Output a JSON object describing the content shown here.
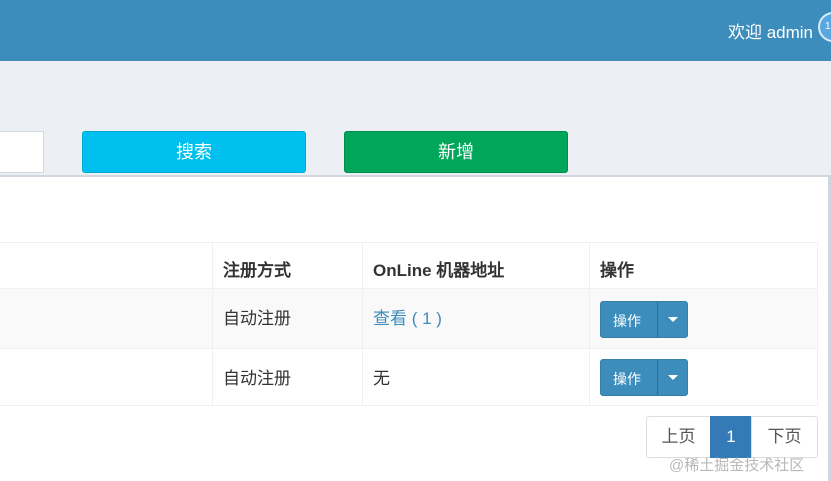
{
  "header": {
    "welcome": "欢迎 admin",
    "avatar_text": "1"
  },
  "toolbar": {
    "search_label": "搜索",
    "add_label": "新增"
  },
  "table": {
    "columns": [
      "注册方式",
      "OnLine 机器地址",
      "操作"
    ],
    "rows": [
      {
        "register": "自动注册",
        "address": "查看 ( 1 )",
        "action": "操作"
      },
      {
        "register": "自动注册",
        "address": "无",
        "action": "操作"
      }
    ]
  },
  "pagination": {
    "prev": "上页",
    "current": "1",
    "next": "下页"
  },
  "watermark": "@稀土掘金技术社区",
  "colors": {
    "header": "#3c8dbc",
    "search": "#00c0ef",
    "add": "#00a65a",
    "primary": "#337ab7"
  }
}
